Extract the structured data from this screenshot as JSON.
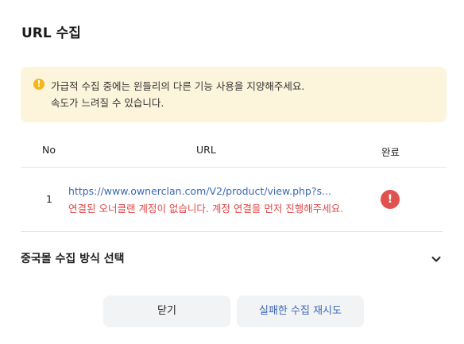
{
  "dialog": {
    "title": "URL 수집"
  },
  "notice": {
    "icon": "exclamation-circle-icon",
    "line1": "가급적 수집 중에는 윈들리의 다른 기능 사용을 지양해주세요.",
    "line2": "속도가 느려질 수 있습니다."
  },
  "table": {
    "headers": {
      "no": "No",
      "url": "URL",
      "done": "완료"
    },
    "rows": [
      {
        "no": "1",
        "url": "https://www.ownerclan.com/V2/product/view.php?s...",
        "error": "연결된 오너클랜 계정이 없습니다. 계정 연결을 먼저 진행해주세요.",
        "status_icon": "error-exclamation-icon",
        "status_color": "#e0524f"
      }
    ]
  },
  "section": {
    "title": "중국몰 수집 방식 선택",
    "icon": "chevron-down-icon"
  },
  "buttons": {
    "close": "닫기",
    "retry": "실패한 수집 재시도"
  },
  "colors": {
    "accent": "#3b68b8",
    "error": "#e04848",
    "notice_bg": "#fdf4dc",
    "warning": "#f3b71b"
  }
}
